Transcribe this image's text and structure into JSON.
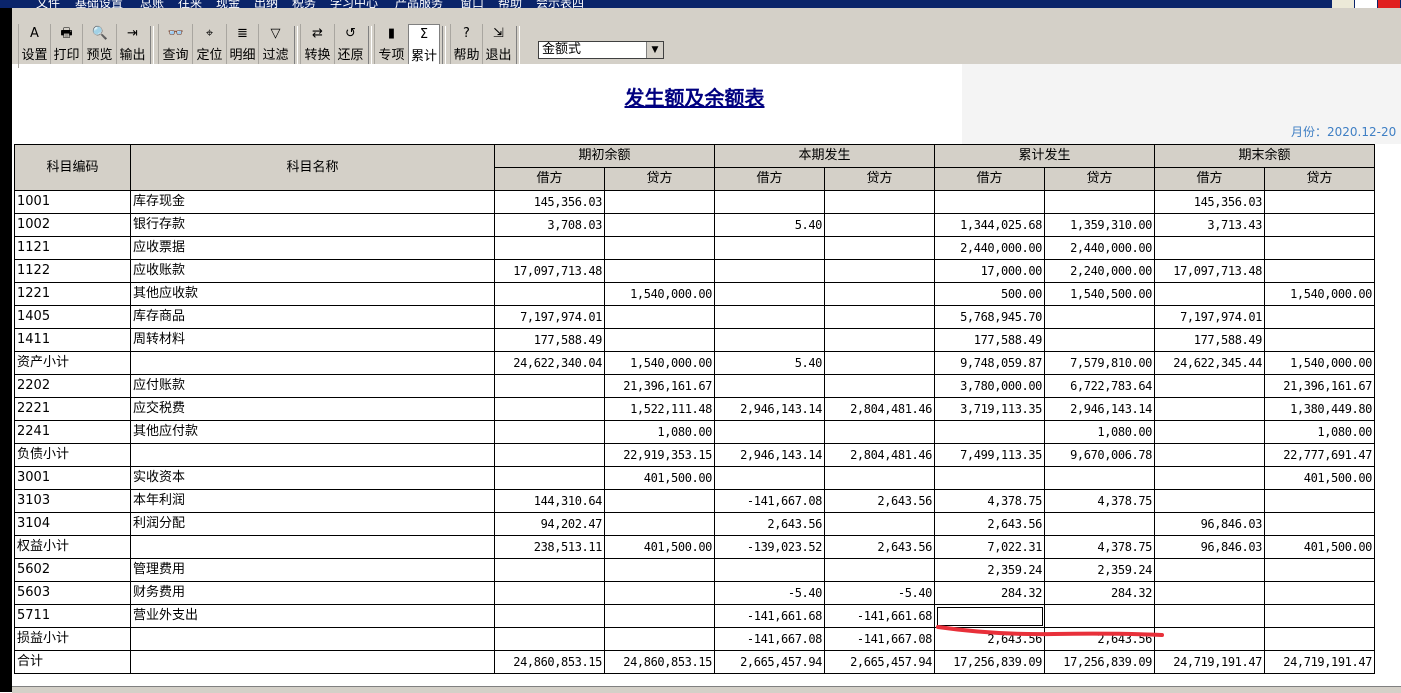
{
  "menu": [
    "文件",
    "基础设置",
    "总账",
    "往来",
    "现金",
    "出纳",
    "税务",
    "学习中心",
    "产品服务",
    "窗口",
    "帮助",
    "会示表四"
  ],
  "toolbar": {
    "buttons": [
      {
        "label": "设置",
        "icon": "A"
      },
      {
        "label": "打印",
        "icon": "🖶"
      },
      {
        "label": "预览",
        "icon": "🔍"
      },
      {
        "label": "输出",
        "icon": "⇥"
      },
      {
        "label": "查询",
        "icon": "👓"
      },
      {
        "label": "定位",
        "icon": "⌖"
      },
      {
        "label": "明细",
        "icon": "≣"
      },
      {
        "label": "过滤",
        "icon": "▽"
      },
      {
        "label": "转换",
        "icon": "⇄"
      },
      {
        "label": "还原",
        "icon": "↺"
      },
      {
        "label": "专项",
        "icon": "▮"
      },
      {
        "label": "累计",
        "icon": "Σ"
      },
      {
        "label": "帮助",
        "icon": "?"
      },
      {
        "label": "退出",
        "icon": "⇲"
      }
    ],
    "view_select": "金额式"
  },
  "report": {
    "title": "发生额及余额表",
    "period": "月份：2020.12-20"
  },
  "table": {
    "col_code": "科目编码",
    "col_name": "科目名称",
    "groups": [
      "期初余额",
      "本期发生",
      "累计发生",
      "期末余额"
    ],
    "sub": [
      "借方",
      "贷方"
    ],
    "rows": [
      [
        "1001",
        "库存现金",
        "145,356.03",
        "",
        "",
        "",
        "",
        "",
        "145,356.03",
        ""
      ],
      [
        "1002",
        "银行存款",
        "3,708.03",
        "",
        "5.40",
        "",
        "1,344,025.68",
        "1,359,310.00",
        "3,713.43",
        ""
      ],
      [
        "1121",
        "应收票据",
        "",
        "",
        "",
        "",
        "2,440,000.00",
        "2,440,000.00",
        "",
        ""
      ],
      [
        "1122",
        "应收账款",
        "17,097,713.48",
        "",
        "",
        "",
        "17,000.00",
        "2,240,000.00",
        "17,097,713.48",
        ""
      ],
      [
        "1221",
        "其他应收款",
        "",
        "1,540,000.00",
        "",
        "",
        "500.00",
        "1,540,500.00",
        "",
        "1,540,000.00"
      ],
      [
        "1405",
        "库存商品",
        "7,197,974.01",
        "",
        "",
        "",
        "5,768,945.70",
        "",
        "7,197,974.01",
        ""
      ],
      [
        "1411",
        "周转材料",
        "177,588.49",
        "",
        "",
        "",
        "177,588.49",
        "",
        "177,588.49",
        ""
      ],
      [
        "资产小计",
        "",
        "24,622,340.04",
        "1,540,000.00",
        "5.40",
        "",
        "9,748,059.87",
        "7,579,810.00",
        "24,622,345.44",
        "1,540,000.00"
      ],
      [
        "2202",
        "应付账款",
        "",
        "21,396,161.67",
        "",
        "",
        "3,780,000.00",
        "6,722,783.64",
        "",
        "21,396,161.67"
      ],
      [
        "2221",
        "应交税费",
        "",
        "1,522,111.48",
        "2,946,143.14",
        "2,804,481.46",
        "3,719,113.35",
        "2,946,143.14",
        "",
        "1,380,449.80"
      ],
      [
        "2241",
        "其他应付款",
        "",
        "1,080.00",
        "",
        "",
        "",
        "1,080.00",
        "",
        "1,080.00"
      ],
      [
        "负债小计",
        "",
        "",
        "22,919,353.15",
        "2,946,143.14",
        "2,804,481.46",
        "7,499,113.35",
        "9,670,006.78",
        "",
        "22,777,691.47"
      ],
      [
        "3001",
        "实收资本",
        "",
        "401,500.00",
        "",
        "",
        "",
        "",
        "",
        "401,500.00"
      ],
      [
        "3103",
        "本年利润",
        "144,310.64",
        "",
        "-141,667.08",
        "2,643.56",
        "4,378.75",
        "4,378.75",
        "",
        ""
      ],
      [
        "3104",
        "利润分配",
        "94,202.47",
        "",
        "2,643.56",
        "",
        "2,643.56",
        "",
        "96,846.03",
        ""
      ],
      [
        "权益小计",
        "",
        "238,513.11",
        "401,500.00",
        "-139,023.52",
        "2,643.56",
        "7,022.31",
        "4,378.75",
        "96,846.03",
        "401,500.00"
      ],
      [
        "5602",
        "管理费用",
        "",
        "",
        "",
        "",
        "2,359.24",
        "2,359.24",
        "",
        ""
      ],
      [
        "5603",
        "财务费用",
        "",
        "",
        "-5.40",
        "-5.40",
        "284.32",
        "284.32",
        "",
        ""
      ],
      [
        "5711",
        "营业外支出",
        "",
        "",
        "-141,661.68",
        "-141,661.68",
        "",
        "",
        "",
        ""
      ],
      [
        "损益小计",
        "",
        "",
        "",
        "-141,667.08",
        "-141,667.08",
        "2,643.56",
        "2,643.56",
        "",
        ""
      ],
      [
        "合计",
        "",
        "24,860,853.15",
        "24,860,853.15",
        "2,665,457.94",
        "2,665,457.94",
        "17,256,839.09",
        "17,256,839.09",
        "24,719,191.47",
        "24,719,191.47"
      ]
    ]
  },
  "colors": {
    "title": "#000080",
    "period": "#3f7fc4",
    "annotation": "#e8303a",
    "toolbar": "#d4d0c8"
  }
}
